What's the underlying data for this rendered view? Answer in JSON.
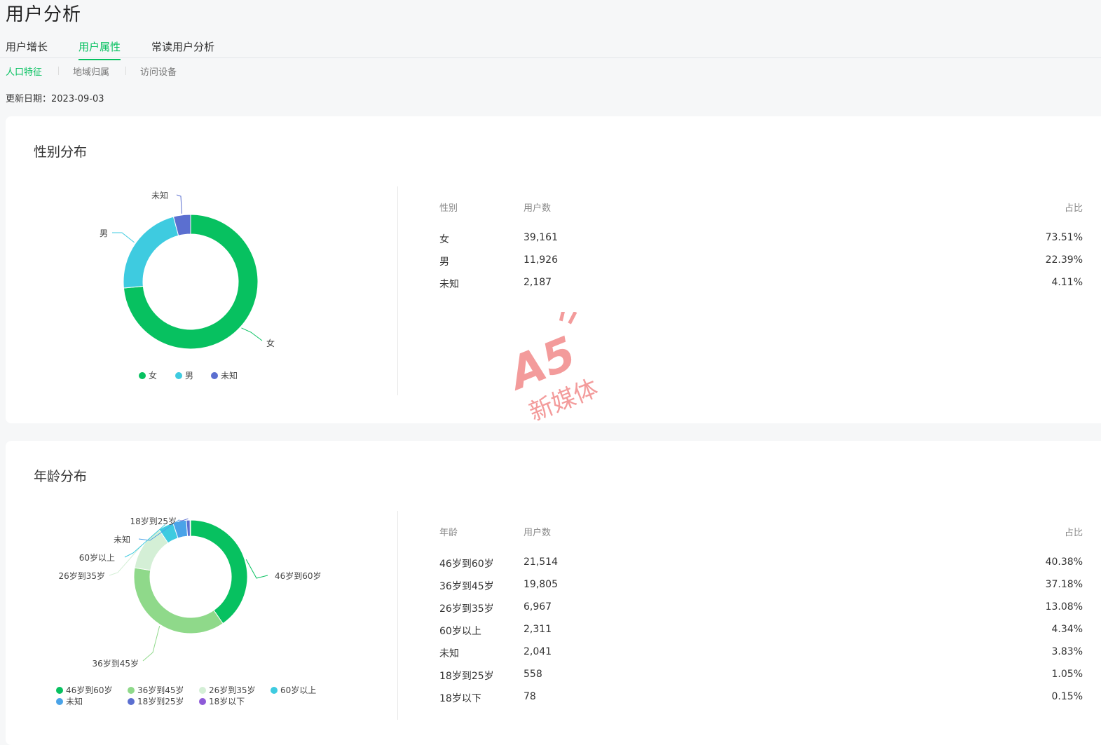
{
  "header": {
    "title": "用户分析"
  },
  "tabs": [
    {
      "label": "用户增长"
    },
    {
      "label": "用户属性"
    },
    {
      "label": "常读用户分析"
    }
  ],
  "subtabs": [
    {
      "label": "人口特征"
    },
    {
      "label": "地域归属"
    },
    {
      "label": "访问设备"
    }
  ],
  "update": {
    "label": "更新日期：",
    "date": "2023-09-03"
  },
  "watermark": {
    "text": "新媒体",
    "logo": "A5"
  },
  "gender": {
    "title": "性别分布",
    "headers": {
      "col1": "性别",
      "col2": "用户数",
      "col3": "占比"
    },
    "rows": [
      {
        "label": "女",
        "count": "39,161",
        "pct": "73.51%"
      },
      {
        "label": "男",
        "count": "11,926",
        "pct": "22.39%"
      },
      {
        "label": "未知",
        "count": "2,187",
        "pct": "4.11%"
      }
    ],
    "legend": [
      "女",
      "男",
      "未知"
    ],
    "colors": [
      "#07c160",
      "#3ecbe0",
      "#5b6fd0"
    ]
  },
  "age": {
    "title": "年龄分布",
    "headers": {
      "col1": "年龄",
      "col2": "用户数",
      "col3": "占比"
    },
    "rows": [
      {
        "label": "46岁到60岁",
        "count": "21,514",
        "pct": "40.38%"
      },
      {
        "label": "36岁到45岁",
        "count": "19,805",
        "pct": "37.18%"
      },
      {
        "label": "26岁到35岁",
        "count": "6,967",
        "pct": "13.08%"
      },
      {
        "label": "60岁以上",
        "count": "2,311",
        "pct": "4.34%"
      },
      {
        "label": "未知",
        "count": "2,041",
        "pct": "3.83%"
      },
      {
        "label": "18岁到25岁",
        "count": "558",
        "pct": "1.05%"
      },
      {
        "label": "18岁以下",
        "count": "78",
        "pct": "0.15%"
      }
    ],
    "legend": [
      "46岁到60岁",
      "36岁到45岁",
      "26岁到35岁",
      "60岁以上",
      "未知",
      "18岁到25岁",
      "18岁以下"
    ],
    "colors": [
      "#07c160",
      "#8fd98a",
      "#d4efd6",
      "#3ecbe0",
      "#4aa3e8",
      "#5b6fd0",
      "#8e5ad8"
    ]
  },
  "chart_data": [
    {
      "type": "pie",
      "categories": [
        "女",
        "男",
        "未知"
      ],
      "values": [
        73.51,
        22.39,
        4.11
      ],
      "title": "性别分布",
      "legend": "bottom"
    },
    {
      "type": "pie",
      "categories": [
        "46岁到60岁",
        "36岁到45岁",
        "26岁到35岁",
        "60岁以上",
        "未知",
        "18岁到25岁",
        "18岁以下"
      ],
      "values": [
        40.38,
        37.18,
        13.08,
        4.34,
        3.83,
        1.05,
        0.15
      ],
      "title": "年龄分布",
      "legend": "bottom"
    }
  ]
}
